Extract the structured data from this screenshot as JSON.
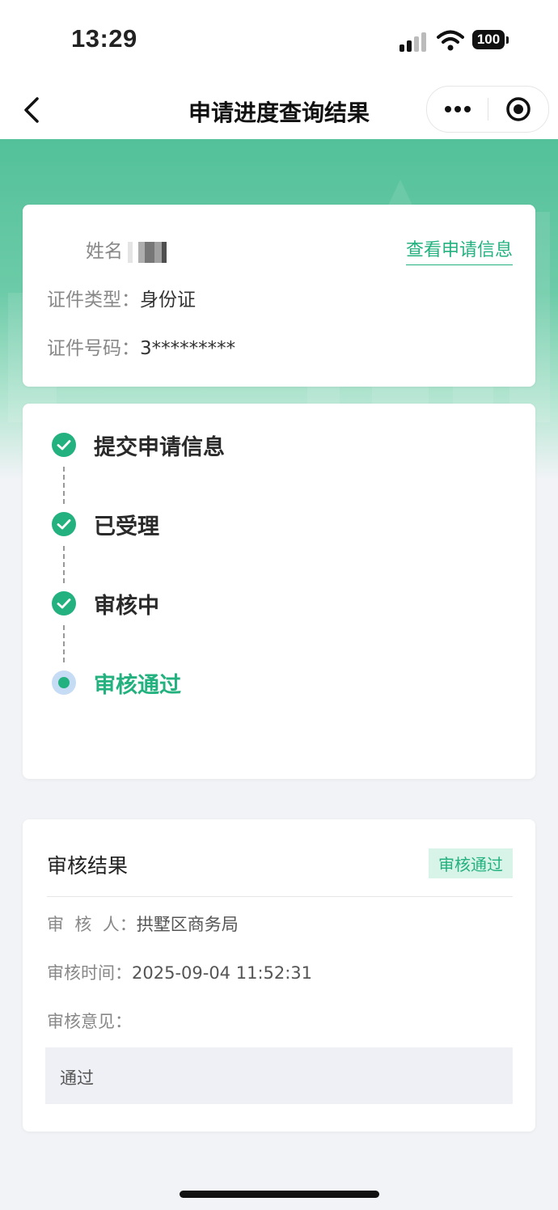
{
  "status_bar": {
    "time": "13:29",
    "battery": "100",
    "icons": [
      "signal-icon",
      "wifi-icon",
      "battery-icon"
    ]
  },
  "nav": {
    "title": "申请进度查询结果",
    "icons": [
      "back-icon",
      "more-icon",
      "target-icon"
    ]
  },
  "applicant": {
    "name_label": "姓名",
    "id_type_label": "证件类型：",
    "id_type_value": "身份证",
    "id_number_label": "证件号码：",
    "id_number_value": "3*********",
    "view_link": "查看申请信息"
  },
  "progress": {
    "steps": [
      {
        "label": "提交申请信息",
        "status": "done"
      },
      {
        "label": "已受理",
        "status": "done"
      },
      {
        "label": "审核中",
        "status": "done"
      },
      {
        "label": "审核通过",
        "status": "active"
      }
    ]
  },
  "result": {
    "title": "审核结果",
    "badge": "审核通过",
    "reviewer_label": "审  核  人：",
    "reviewer_value": "拱墅区商务局",
    "time_label": "审核时间：",
    "time_value": "2025-09-04 11:52:31",
    "opinion_label": "审核意见：",
    "opinion_value": "通过"
  },
  "colors": {
    "accent": "#23b27f",
    "hero_green": "#53c19a",
    "badge_bg": "#d8f4e8",
    "active_dot_ring": "#c6dcf5",
    "page_bg": "#f1f3f6"
  }
}
